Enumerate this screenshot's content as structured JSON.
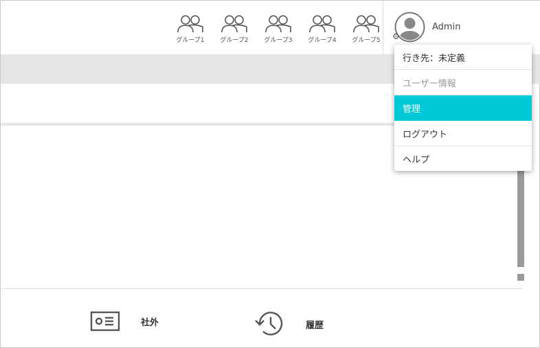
{
  "groups": [
    {
      "label": "グループ1",
      "icon": "group-icon"
    },
    {
      "label": "グループ2",
      "icon": "group-icon"
    },
    {
      "label": "グループ3",
      "icon": "group-icon"
    },
    {
      "label": "グループ4",
      "icon": "group-icon"
    },
    {
      "label": "グループ5",
      "icon": "group-icon"
    }
  ],
  "user": {
    "name": "Admin",
    "avatar_icon": "user-avatar-icon",
    "settings_icon": "gear-icon"
  },
  "dropdown": {
    "destination": "行き先：未定義",
    "user_info_header": "ユーザー情報",
    "admin": "管理",
    "logout": "ログアウト",
    "help": "ヘルプ",
    "active_color": "#00c9d8"
  },
  "footer": {
    "external": {
      "label": "社外",
      "icon": "id-card-icon"
    },
    "history": {
      "label": "履歴",
      "icon": "history-icon"
    }
  }
}
